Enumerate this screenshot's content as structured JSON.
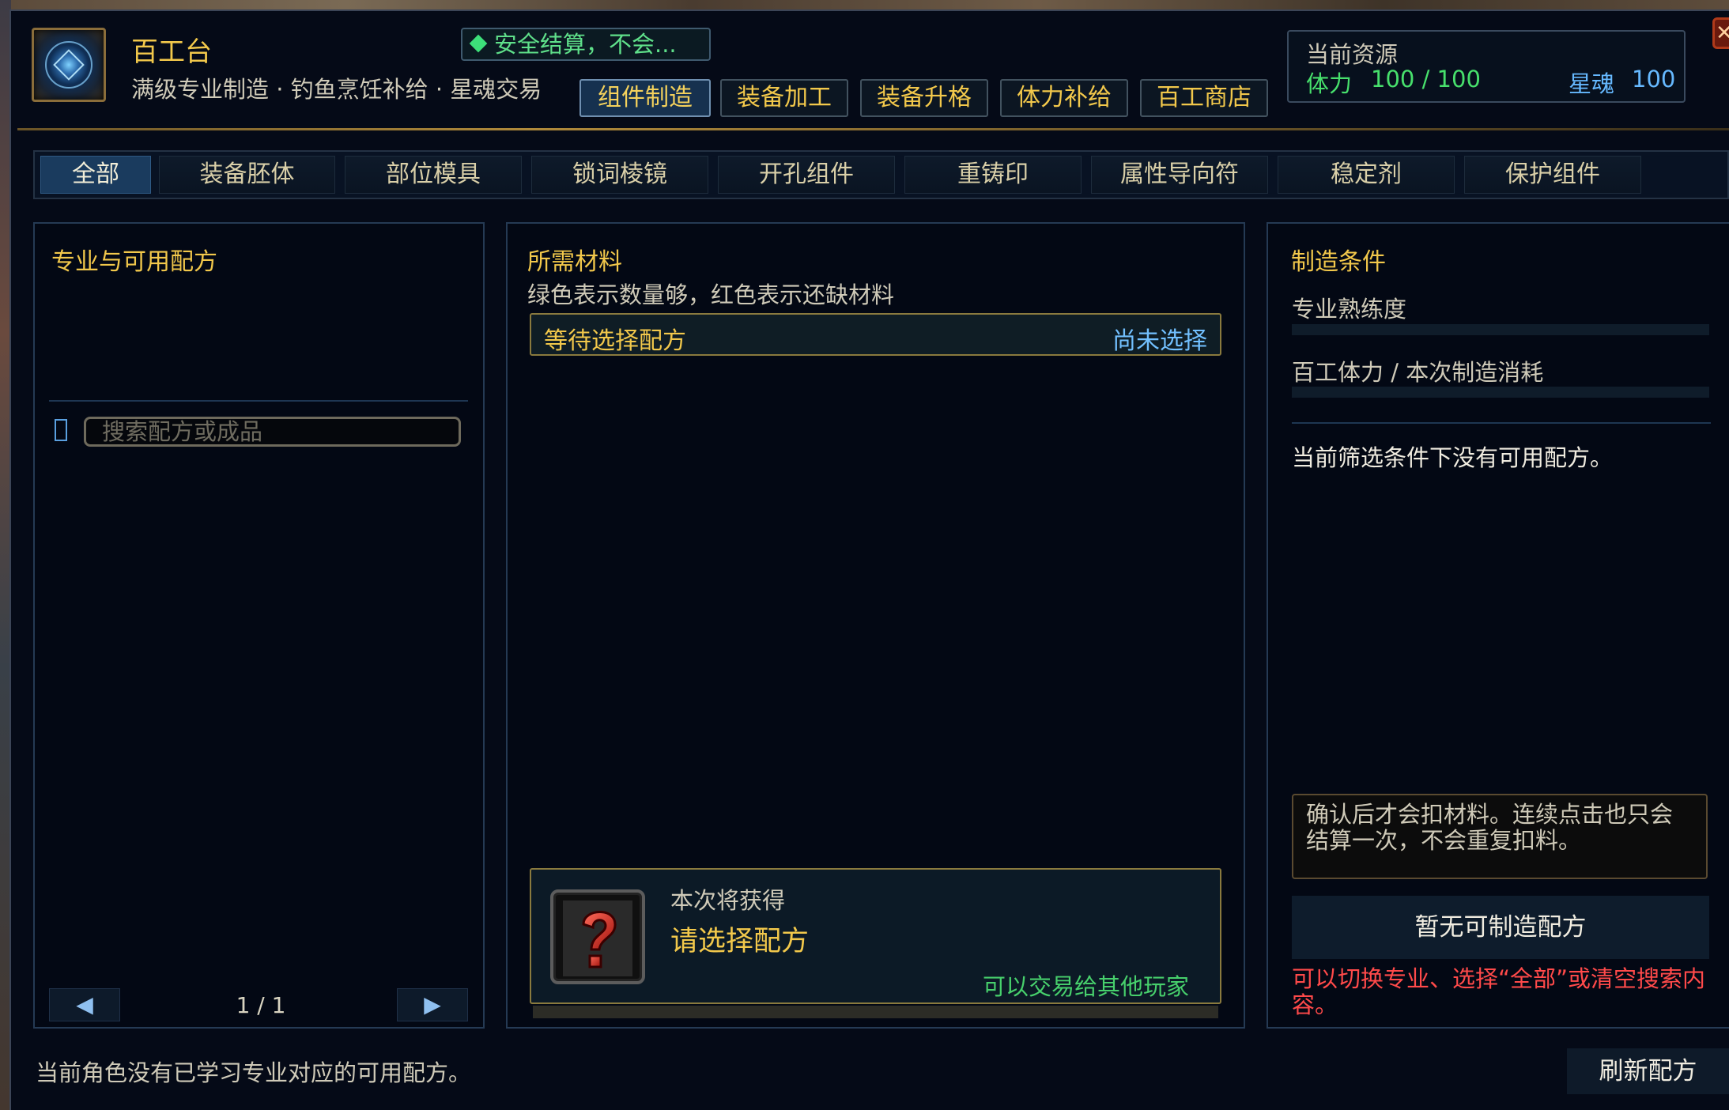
{
  "window": {
    "title": "百工台",
    "subtitle": "满级专业制造 · 钓鱼烹饪补给 · 星魂交易",
    "safe_badge": "安全结算，不会...",
    "close_label": "✕"
  },
  "top_tabs": [
    {
      "label": "组件制造",
      "active": true
    },
    {
      "label": "装备加工",
      "active": false
    },
    {
      "label": "装备升格",
      "active": false
    },
    {
      "label": "体力补给",
      "active": false
    },
    {
      "label": "百工商店",
      "active": false
    }
  ],
  "resources": {
    "title": "当前资源",
    "stamina_label": "体力",
    "stamina_value": "100 / 100",
    "soul_label": "星魂",
    "soul_value": "100"
  },
  "categories": [
    {
      "label": "全部",
      "active": true
    },
    {
      "label": "装备胚体",
      "active": false
    },
    {
      "label": "部位模具",
      "active": false
    },
    {
      "label": "锁词棱镜",
      "active": false
    },
    {
      "label": "开孔组件",
      "active": false
    },
    {
      "label": "重铸印",
      "active": false
    },
    {
      "label": "属性导向符",
      "active": false
    },
    {
      "label": "稳定剂",
      "active": false
    },
    {
      "label": "保护组件",
      "active": false
    }
  ],
  "recipes_panel": {
    "title": "专业与可用配方",
    "search_placeholder": "搜索配方或成品",
    "search_value": "",
    "prev_label": "◀",
    "next_label": "▶",
    "page": "1 / 1"
  },
  "materials_panel": {
    "title": "所需材料",
    "note": "绿色表示数量够，红色表示还缺材料",
    "row_label": "等待选择配方",
    "row_status": "尚未选择",
    "result_label": "本次将获得",
    "result_name": "请选择配方",
    "result_trade": "可以交易给其他玩家"
  },
  "conditions_panel": {
    "title": "制造条件",
    "proficiency_label": "专业熟练度",
    "stamina_cost_label": "百工体力 / 本次制造消耗",
    "empty_message": "当前筛选条件下没有可用配方。",
    "warning": "确认后才会扣材料。连续点击也只会结算一次，不会重复扣料。",
    "craft_button": "暂无可制造配方",
    "hint": "可以切换专业、选择“全部”或清空搜索内容。"
  },
  "footer": {
    "status": "当前角色没有已学习专业对应的可用配方。",
    "refresh_button": "刷新配方"
  },
  "colors": {
    "gold": "#f2c84b",
    "green": "#47e06c",
    "blue": "#66b9ff",
    "red": "#ff4a4a",
    "panel_bg": "#030814"
  }
}
